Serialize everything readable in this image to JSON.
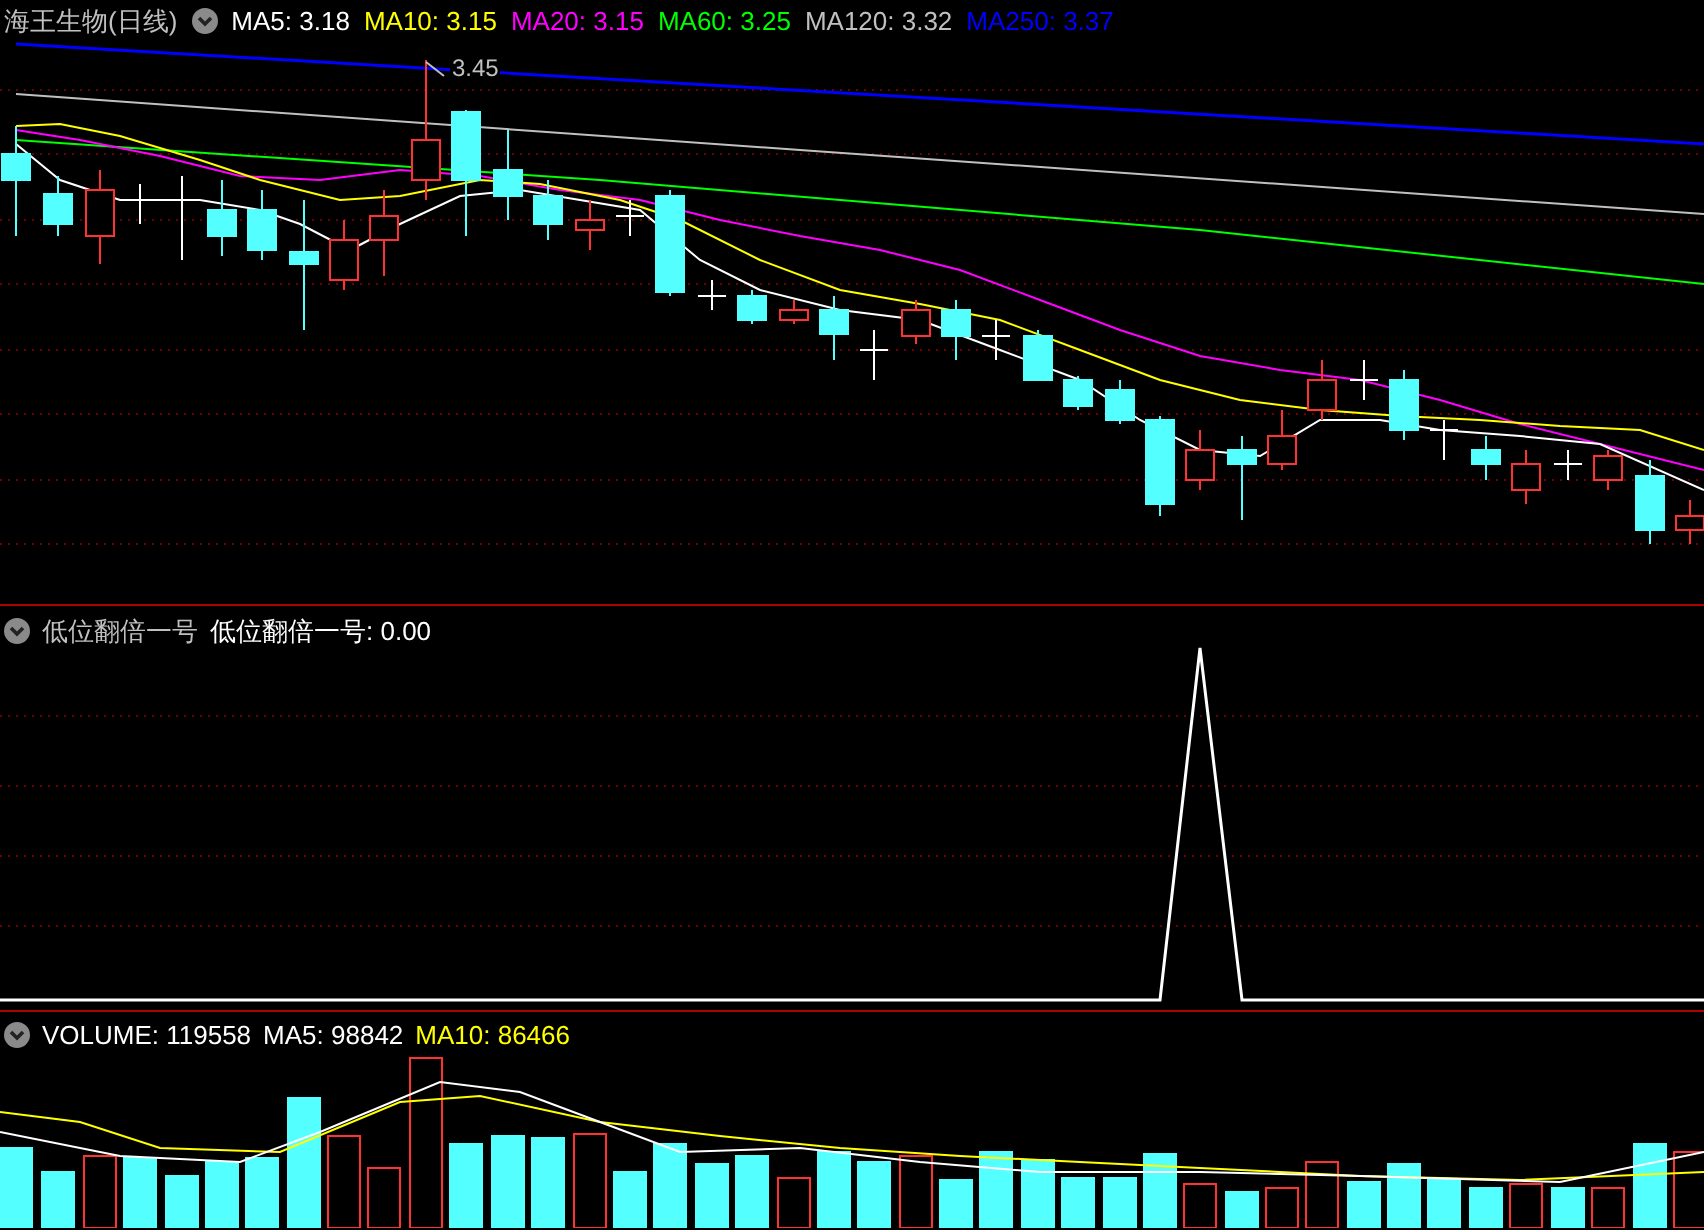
{
  "title": "海王生物(日线)",
  "price_legend": [
    {
      "label": "MA5: 3.18",
      "color": "#ffffff"
    },
    {
      "label": "MA10: 3.15",
      "color": "#ffff00"
    },
    {
      "label": "MA20: 3.15",
      "color": "#ff00ff"
    },
    {
      "label": "MA60: 3.25",
      "color": "#00ff00"
    },
    {
      "label": "MA120: 3.32",
      "color": "#c0c0c0"
    },
    {
      "label": "MA250: 3.37",
      "color": "#0000ff"
    }
  ],
  "high_label": "3.45",
  "indicator": {
    "name": "低位翻倍一号",
    "legend": [
      {
        "label": "低位翻倍一号: 0.00",
        "color": "#ffffff"
      }
    ]
  },
  "volume_legend": [
    {
      "label": "VOLUME: 119558",
      "color": "#ffffff"
    },
    {
      "label": "MA5: 98842",
      "color": "#ffffff"
    },
    {
      "label": "MA10: 86466",
      "color": "#ffff00"
    }
  ]
}
